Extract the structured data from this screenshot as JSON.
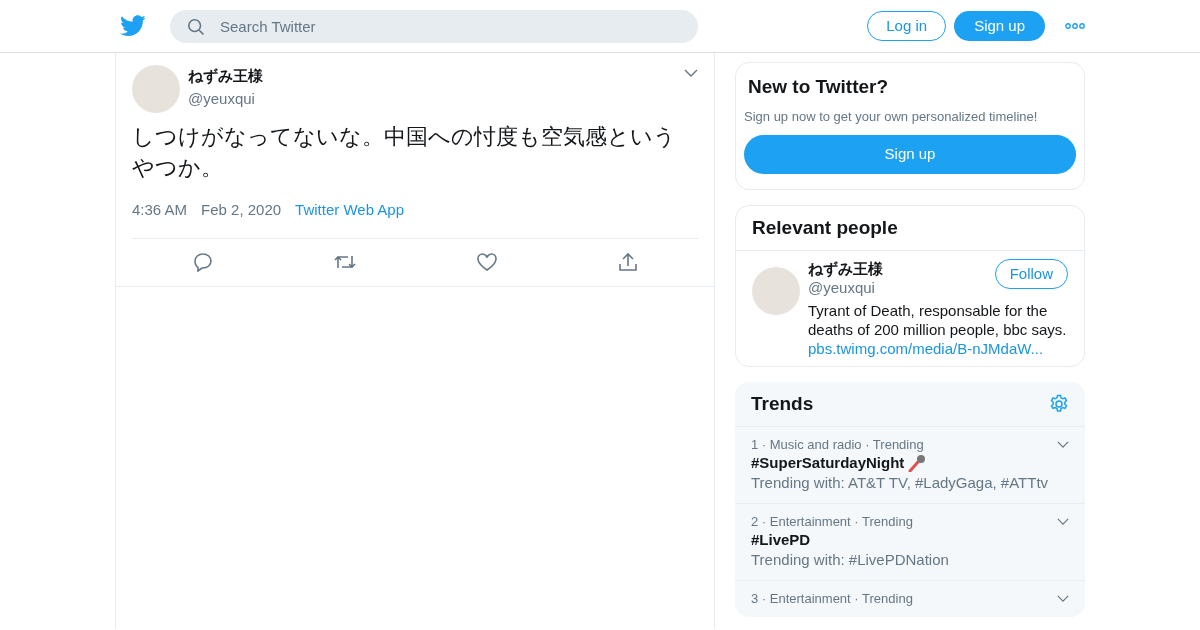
{
  "header": {
    "search": {
      "placeholder": "Search Twitter"
    },
    "login": "Log in",
    "signup": "Sign up"
  },
  "tweet": {
    "name": "ねずみ王様",
    "handle": "@yeuxqui",
    "text": "しつけがなってないな。中国への忖度も空気感というやつか。",
    "time": "4:36 AM",
    "date": "Feb 2, 2020",
    "source": "Twitter Web App"
  },
  "signup_card": {
    "title": "New to Twitter?",
    "text": "Sign up now to get your own personalized timeline!",
    "button": "Sign up"
  },
  "people_card": {
    "title": "Relevant people",
    "people": [
      {
        "name": "ねずみ王様",
        "handle": "@yeuxqui",
        "bio": "Tyrant of Death, responsable for the deaths of 200 million people, bbc says.",
        "link": "pbs.twimg.com/media/B-nJMdaW...",
        "follow": "Follow"
      }
    ]
  },
  "trends": {
    "title": "Trends",
    "items": [
      {
        "meta": "1 · Music and radio · Trending",
        "name": "#SuperSaturdayNight",
        "emoji": true,
        "with": "Trending with: AT&T TV, #LadyGaga, #ATTtv"
      },
      {
        "meta": "2 · Entertainment · Trending",
        "name": "#LivePD",
        "emoji": false,
        "with": "Trending with: #LivePDNation"
      },
      {
        "meta": "3 · Entertainment · Trending"
      }
    ]
  }
}
